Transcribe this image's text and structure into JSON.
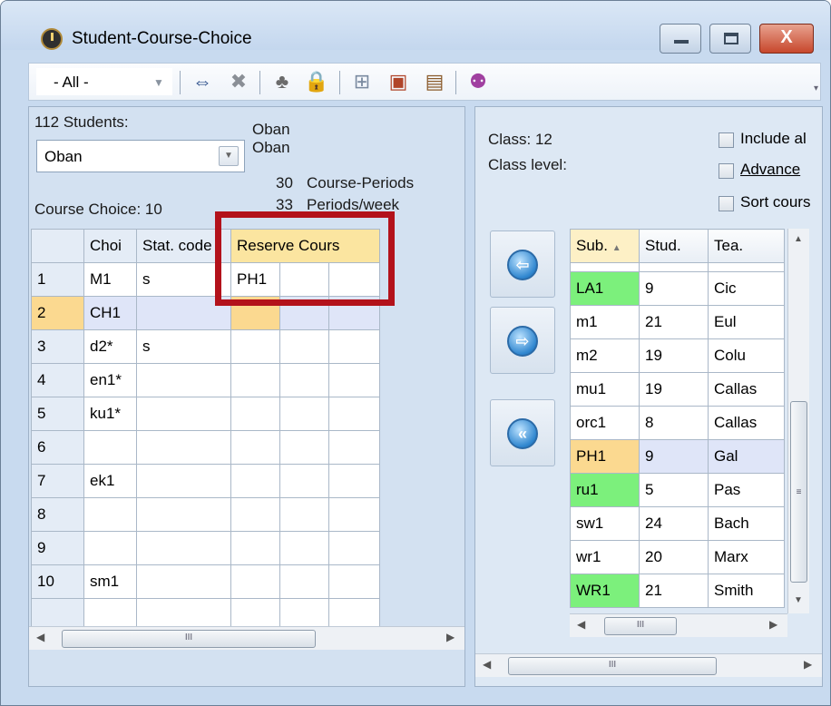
{
  "window": {
    "title": "Student-Course-Choice",
    "close_glyph": "X"
  },
  "toolbar": {
    "filter_value": "- All -",
    "icons": [
      "swap-arrows-icon",
      "delete-x-icon",
      "hierarchy-icon",
      "lock-icon",
      "grid-icon",
      "cancel-schedule-icon",
      "print-icon",
      "users-icon"
    ]
  },
  "left": {
    "student_count": "112 Students:",
    "student_name1": "Oban",
    "student_name2": "Oban",
    "student_selected": "Oban",
    "course_periods_num": "30",
    "course_periods_label": "Course-Periods",
    "periods_week_num": "33",
    "periods_week_label": "Periods/week",
    "course_choice": "Course Choice: 10",
    "headers": [
      "Choi",
      "Stat. code",
      "Reserve Cours",
      "",
      ""
    ],
    "rows": [
      {
        "n": "1",
        "choice": "M1",
        "stat": "s",
        "r1": "PH1"
      },
      {
        "n": "2",
        "choice": "CH1",
        "stat": "",
        "r1": ""
      },
      {
        "n": "3",
        "choice": "d2*",
        "stat": "s",
        "r1": ""
      },
      {
        "n": "4",
        "choice": "en1*",
        "stat": "",
        "r1": ""
      },
      {
        "n": "5",
        "choice": "ku1*",
        "stat": "",
        "r1": ""
      },
      {
        "n": "6",
        "choice": "",
        "stat": "",
        "r1": ""
      },
      {
        "n": "7",
        "choice": "ek1",
        "stat": "",
        "r1": ""
      },
      {
        "n": "8",
        "choice": "",
        "stat": "",
        "r1": ""
      },
      {
        "n": "9",
        "choice": "",
        "stat": "",
        "r1": ""
      },
      {
        "n": "10",
        "choice": "sm1",
        "stat": "",
        "r1": ""
      },
      {
        "n": "",
        "choice": "",
        "stat": "",
        "r1": ""
      }
    ],
    "scroll_thumb": "III"
  },
  "right": {
    "class_label": "Class: 12",
    "class_level_label": "Class level:",
    "include_label": "Include al",
    "advance_label": "Advance",
    "sort_label": "Sort cours",
    "headers": [
      "Sub.",
      "Stud.",
      "Tea."
    ],
    "rows": [
      {
        "sub": "LA1",
        "stud": "9",
        "tea": "Cic",
        "color": "green"
      },
      {
        "sub": "m1",
        "stud": "21",
        "tea": "Eul",
        "color": ""
      },
      {
        "sub": "m2",
        "stud": "19",
        "tea": "Colu",
        "color": ""
      },
      {
        "sub": "mu1",
        "stud": "19",
        "tea": "Callas",
        "color": ""
      },
      {
        "sub": "orc1",
        "stud": "8",
        "tea": "Callas",
        "color": ""
      },
      {
        "sub": "PH1",
        "stud": "9",
        "tea": "Gal",
        "color": "orange"
      },
      {
        "sub": "ru1",
        "stud": "5",
        "tea": "Pas",
        "color": "green"
      },
      {
        "sub": "sw1",
        "stud": "24",
        "tea": "Bach",
        "color": ""
      },
      {
        "sub": "wr1",
        "stud": "20",
        "tea": "Marx",
        "color": ""
      },
      {
        "sub": "WR1",
        "stud": "21",
        "tea": "Smith",
        "color": "green"
      }
    ],
    "scroll_thumb": "III"
  },
  "colors": {
    "highlight_box": "#b3121b",
    "green_subject": "#7cf07c",
    "orange_selection": "#fbd990"
  }
}
